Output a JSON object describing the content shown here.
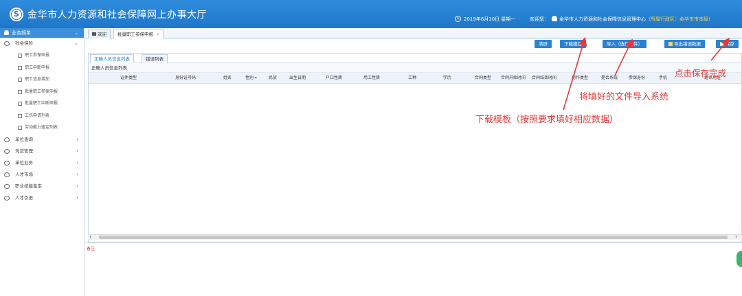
{
  "header": {
    "logo_text": "S",
    "title": "金华市人力资源和社会保障网上办事大厅",
    "date": "2019年6月10日 星期一",
    "welcome_prefix": "欢迎您：",
    "org": "金华市人力资源和社会保障信息管理中心",
    "region": "（所属行政区：金华市市本级）"
  },
  "sidebar": {
    "head": "业务频单",
    "groups": [
      {
        "label": "社会保险",
        "expanded": true
      },
      {
        "label": "单位查询"
      },
      {
        "label": "凭证管理"
      },
      {
        "label": "单位业务"
      },
      {
        "label": "人才市场"
      },
      {
        "label": "职业技能鉴定"
      },
      {
        "label": "人才引进"
      }
    ],
    "sub_items": [
      "职工参保申报",
      "职工中断申报",
      "职工信息增加",
      "批量职工参保申报",
      "批量职工中断申报",
      "工伤申请列表",
      "劳动能力鉴定列表"
    ]
  },
  "tabs": {
    "home": "欢迎",
    "active": "批量职工参保申报",
    "close": "×"
  },
  "toolbar": {
    "clear": "清屏",
    "download": "下载模板",
    "import": "导入（选择文件）",
    "export": "导出错误数据",
    "save": "保存"
  },
  "subtabs": [
    "正确人员信息列表",
    "错误列表"
  ],
  "section_title": "正确人员信息列表",
  "columns": [
    "证件类型",
    "身份证号码",
    "姓名",
    "性别",
    "民族",
    "出生日期",
    "户口性质",
    "用工性质",
    "工种",
    "学历",
    "合同类型",
    "合同开始时间",
    "合同结束时间",
    "用作类型",
    "是否系统",
    "参保身份",
    "手机",
    "通讯地址"
  ],
  "note_label": "备注",
  "annotations": {
    "save": "点击保存完成",
    "import": "将填好的文件导入系统",
    "download": "下载模板（按照要求填好相应数据）"
  },
  "colors": {
    "header_blue": "#2f8ddd",
    "button_blue": "#2b82d4",
    "annotation_red": "#e53935",
    "region_yellow": "#ffd54a"
  }
}
